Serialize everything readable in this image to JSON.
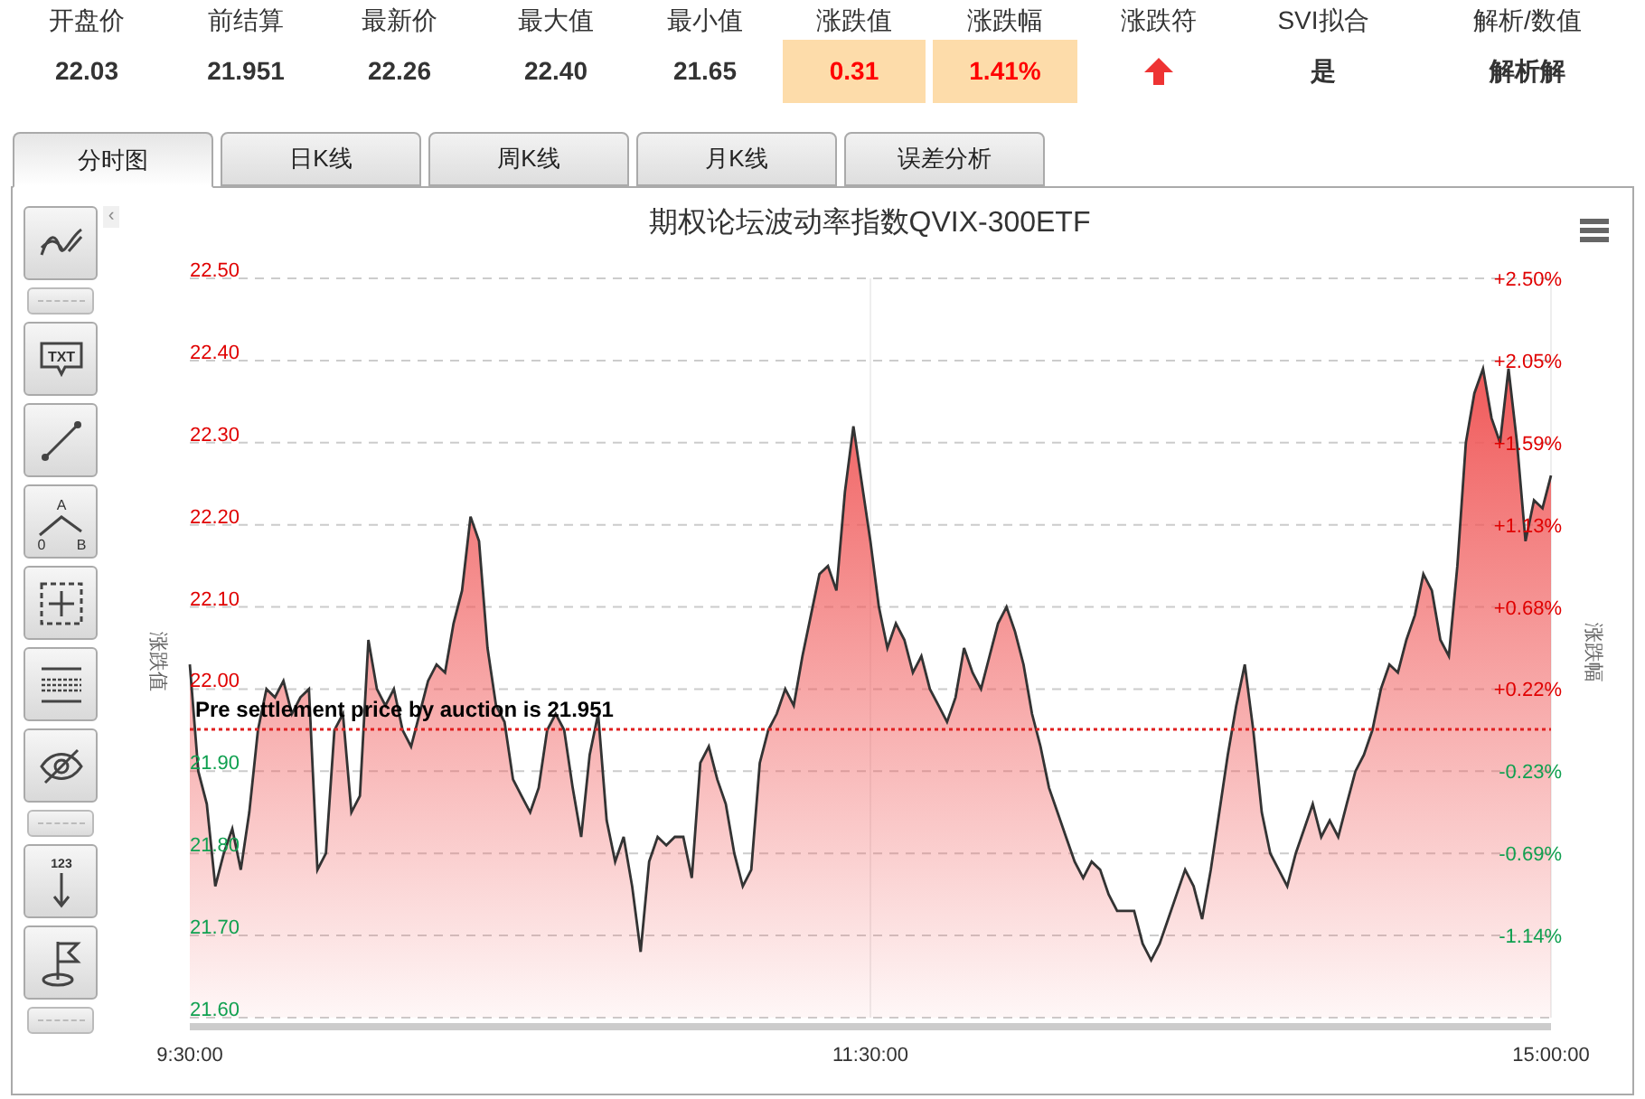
{
  "quote_table": {
    "columns": [
      {
        "header": "开盘价",
        "value": "22.03",
        "kind": "plain"
      },
      {
        "header": "前结算",
        "value": "21.951",
        "kind": "plain"
      },
      {
        "header": "最新价",
        "value": "22.26",
        "kind": "plain"
      },
      {
        "header": "最大值",
        "value": "22.40",
        "kind": "plain"
      },
      {
        "header": "最小值",
        "value": "21.65",
        "kind": "plain"
      },
      {
        "header": "涨跌值",
        "value": "0.31",
        "kind": "highlight"
      },
      {
        "header": "涨跌幅",
        "value": "1.41%",
        "kind": "highlight"
      },
      {
        "header": "涨跌符",
        "kind": "up_arrow"
      },
      {
        "header": "SVI拟合",
        "value": "是",
        "kind": "plain"
      },
      {
        "header": "解析/数值",
        "value": "解析解",
        "kind": "plain"
      }
    ]
  },
  "tabs": [
    {
      "label": "分时图",
      "selected": true
    },
    {
      "label": "日K线",
      "selected": false
    },
    {
      "label": "周K线",
      "selected": false
    },
    {
      "label": "月K线",
      "selected": false
    },
    {
      "label": "误差分析",
      "selected": false
    }
  ],
  "toolbar": {
    "collapse": "‹",
    "tools": [
      {
        "kind": "lines"
      },
      {
        "kind": "separator"
      },
      {
        "kind": "text",
        "texts": [
          "TXT"
        ]
      },
      {
        "kind": "segment"
      },
      {
        "kind": "angle",
        "texts": [
          "A",
          "0",
          "B"
        ]
      },
      {
        "kind": "select"
      },
      {
        "kind": "grid"
      },
      {
        "kind": "hide"
      },
      {
        "kind": "separator"
      },
      {
        "kind": "numbers",
        "texts": [
          "123"
        ]
      },
      {
        "kind": "flag"
      },
      {
        "kind": "separator"
      }
    ]
  },
  "chart": {
    "right_label": "涨跌幅",
    "right_ticks": [
      {
        "label": "+2.50%",
        "color": "#e00000"
      },
      {
        "label": "+2.05%",
        "color": "#e00000"
      },
      {
        "label": "+1.59%",
        "color": "#e00000"
      },
      {
        "label": "+1.13%",
        "color": "#e00000"
      },
      {
        "label": "+0.68%",
        "color": "#e00000"
      },
      {
        "label": "+0.22%",
        "color": "#e00000"
      },
      {
        "label": "-0.23%",
        "color": "#10a050"
      },
      {
        "label": "-0.69%",
        "color": "#10a050"
      },
      {
        "label": "-1.14%",
        "color": "#10a050"
      }
    ],
    "time_labels": [
      "9:30:00",
      "11:30:00",
      "15:00:00"
    ],
    "chart_data": {
      "type": "area",
      "title": "期权论坛波动率指数QVIX-300ETF",
      "ylabel": "涨跌值",
      "ylim": [
        21.6,
        22.5
      ],
      "grid": true,
      "yticks": [
        {
          "value": 22.5,
          "label": "22.50"
        },
        {
          "value": 22.4,
          "label": "22.40"
        },
        {
          "value": 22.3,
          "label": "22.30"
        },
        {
          "value": 22.2,
          "label": "22.20"
        },
        {
          "value": 22.1,
          "label": "22.10"
        },
        {
          "value": 22.0,
          "label": "22.00"
        },
        {
          "value": 21.9,
          "label": "21.90"
        },
        {
          "value": 21.8,
          "label": "21.80"
        },
        {
          "value": 21.7,
          "label": "21.70"
        },
        {
          "value": 21.6,
          "label": "21.60"
        }
      ],
      "series": [
        {
          "color": "#f05a5a",
          "values": [
            22.03,
            21.9,
            21.86,
            21.76,
            21.8,
            21.83,
            21.78,
            21.85,
            21.95,
            22.0,
            21.99,
            22.01,
            21.97,
            21.99,
            22.0,
            21.78,
            21.8,
            21.95,
            21.97,
            21.85,
            21.87,
            22.06,
            22.0,
            21.98,
            22.0,
            21.95,
            21.93,
            21.97,
            22.01,
            22.03,
            22.02,
            22.08,
            22.12,
            22.21,
            22.18,
            22.05,
            21.98,
            21.96,
            21.89,
            21.87,
            21.85,
            21.88,
            21.95,
            21.97,
            21.95,
            21.88,
            21.82,
            21.92,
            21.97,
            21.84,
            21.79,
            21.82,
            21.76,
            21.68,
            21.79,
            21.82,
            21.81,
            21.82,
            21.82,
            21.77,
            21.91,
            21.93,
            21.89,
            21.86,
            21.8,
            21.76,
            21.78,
            21.91,
            21.95,
            21.97,
            22.0,
            21.98,
            22.04,
            22.09,
            22.14,
            22.15,
            22.12,
            22.24,
            22.32,
            22.25,
            22.18,
            22.1,
            22.05,
            22.08,
            22.06,
            22.02,
            22.04,
            22.0,
            21.98,
            21.96,
            21.99,
            22.05,
            22.02,
            22.0,
            22.04,
            22.08,
            22.1,
            22.07,
            22.03,
            21.97,
            21.93,
            21.88,
            21.85,
            21.82,
            21.79,
            21.77,
            21.79,
            21.78,
            21.75,
            21.73,
            21.73,
            21.73,
            21.69,
            21.67,
            21.69,
            21.72,
            21.75,
            21.78,
            21.76,
            21.72,
            21.78,
            21.85,
            21.92,
            21.98,
            22.03,
            21.95,
            21.85,
            21.8,
            21.78,
            21.76,
            21.8,
            21.83,
            21.86,
            21.82,
            21.84,
            21.82,
            21.86,
            21.9,
            21.92,
            21.95,
            22.0,
            22.03,
            22.02,
            22.06,
            22.09,
            22.14,
            22.12,
            22.06,
            22.04,
            22.15,
            22.3,
            22.36,
            22.39,
            22.33,
            22.3,
            22.39,
            22.3,
            22.18,
            22.23,
            22.22,
            22.26
          ]
        }
      ],
      "ref_lines": [
        {
          "axis": "y",
          "value": 21.951,
          "color": "#e02020"
        }
      ],
      "annotations": [
        {
          "text": "Pre settlement price by auction is 21.951",
          "y": 21.951
        }
      ]
    }
  }
}
